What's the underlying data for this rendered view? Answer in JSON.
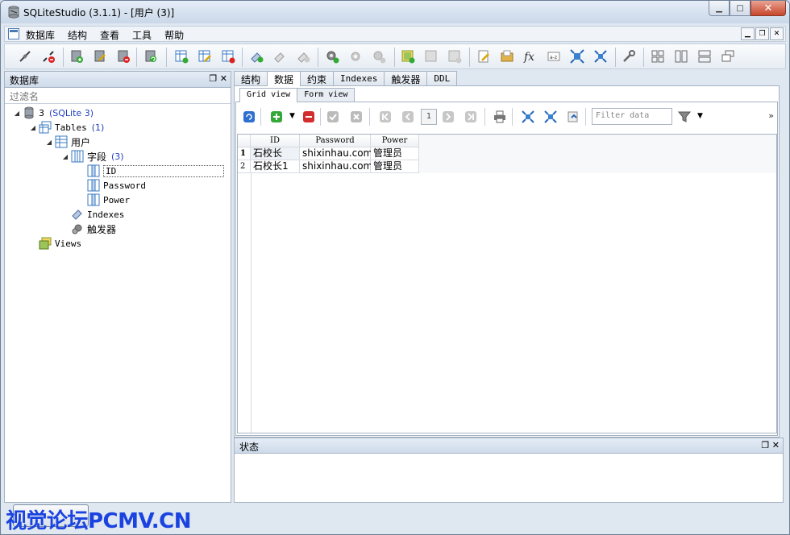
{
  "window": {
    "title": "SQLiteStudio (3.1.1) - [用户 (3)]"
  },
  "menu": {
    "items": [
      "数据库",
      "结构",
      "查看",
      "工具",
      "帮助"
    ]
  },
  "db_panel": {
    "title": "数据库",
    "filter_placeholder": "过滤名",
    "tree": {
      "db_name": "3",
      "db_type": "(SQLite 3)",
      "tables_label": "Tables",
      "tables_count": "(1)",
      "table_name": "用户",
      "columns_label": "字段",
      "columns_count": "(3)",
      "columns": [
        "ID",
        "Password",
        "Power"
      ],
      "indexes_label": "Indexes",
      "triggers_label": "触发器",
      "views_label": "Views"
    }
  },
  "main_tabs": [
    "结构",
    "数据",
    "约束",
    "Indexes",
    "触发器",
    "DDL"
  ],
  "active_tab": "数据",
  "sub_tabs": [
    "Grid view",
    "Form view"
  ],
  "grid": {
    "page": "1",
    "filter_placeholder": "Filter data",
    "more": "»",
    "columns": [
      "ID",
      "Password",
      "Power"
    ],
    "rows": [
      {
        "num": "1",
        "cells": [
          "石校长",
          "shixinhau.com",
          "管理员"
        ]
      },
      {
        "num": "2",
        "cells": [
          "石校长1",
          "shixinhau.com",
          "管理员"
        ]
      }
    ]
  },
  "status_panel": {
    "title": "状态"
  },
  "watermark": "视觉论坛PCMV.CN"
}
